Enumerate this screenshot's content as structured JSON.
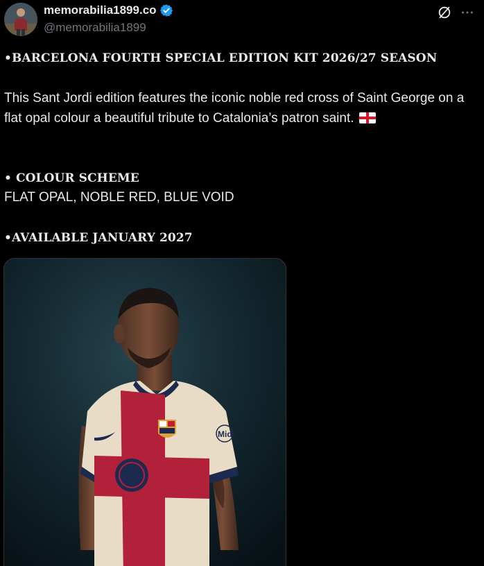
{
  "author": {
    "display_name": "memorabilia1899.co",
    "handle": "@memorabilia1899",
    "verified_color": "#1d9bf0"
  },
  "header_icons": {
    "grok": "grok-icon",
    "more": "more-icon"
  },
  "post": {
    "title_line": "•BARCELONA FOURTH SPECIAL EDITION KIT 2026/27 SEASON",
    "description": "This Sant Jordi edition features the iconic noble red cross of Saint George on a flat opal colour a beautiful tribute to Catalonia’s patron saint.",
    "flag_icon": "england-flag-icon",
    "colour_heading": "• COLOUR SCHEME",
    "colour_values": "FLAT OPAL, NOBLE RED, BLUE VOID",
    "availability": "•AVAILABLE JANUARY 2027"
  },
  "media": {
    "kind": "photo",
    "sponsor_text": "Mid"
  },
  "colors": {
    "background": "#000000",
    "text": "#e7e9ea",
    "muted": "#71767b",
    "accent": "#1d9bf0",
    "kit_opal": "#e8dcc6",
    "kit_red": "#b3203a",
    "kit_navy": "#1c2a4f"
  }
}
